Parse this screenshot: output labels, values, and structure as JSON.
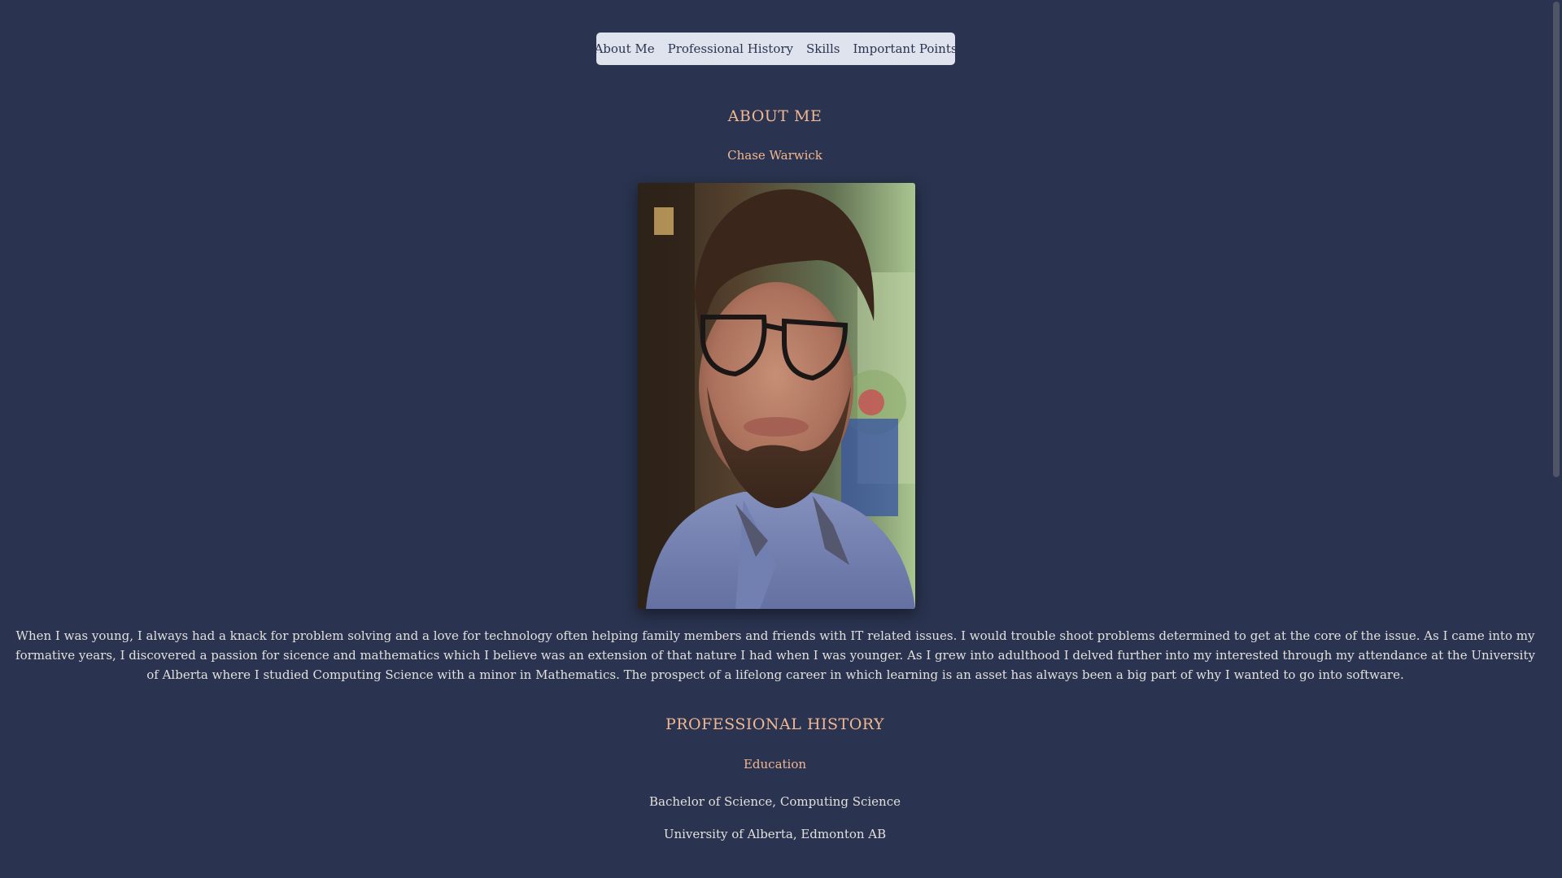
{
  "nav": {
    "items": [
      {
        "label": "About Me"
      },
      {
        "label": "Professional History"
      },
      {
        "label": "Skills"
      },
      {
        "label": "Important Points"
      }
    ]
  },
  "about": {
    "heading": "ABOUT ME",
    "name": "Chase Warwick",
    "photo_icon": "portrait-photo",
    "bio": "When I was young, I always had a knack for problem solving and a love for technology often helping family members and friends with IT related issues. I would trouble shoot problems determined to get at the core of the issue. As I came into my formative years, I discovered a passion for sicence and mathematics which I believe was an extension of that nature I had when I was younger. As I grew into adulthood I delved further into my interested through my attendance at the University of Alberta where I studied Computing Science with a minor in Mathematics. The prospect of a lifelong career in which learning is an asset has always been a big part of why I wanted to go into software."
  },
  "professional": {
    "heading": "PROFESSIONAL HISTORY",
    "education_heading": "Education",
    "degree": "Bachelor of Science, Computing Science",
    "school": "University of Alberta, Edmonton AB"
  },
  "colors": {
    "background": "#2a334f",
    "accent": "#f2b791",
    "nav_background": "#dfe3ee",
    "text": "#e3e1dc"
  }
}
